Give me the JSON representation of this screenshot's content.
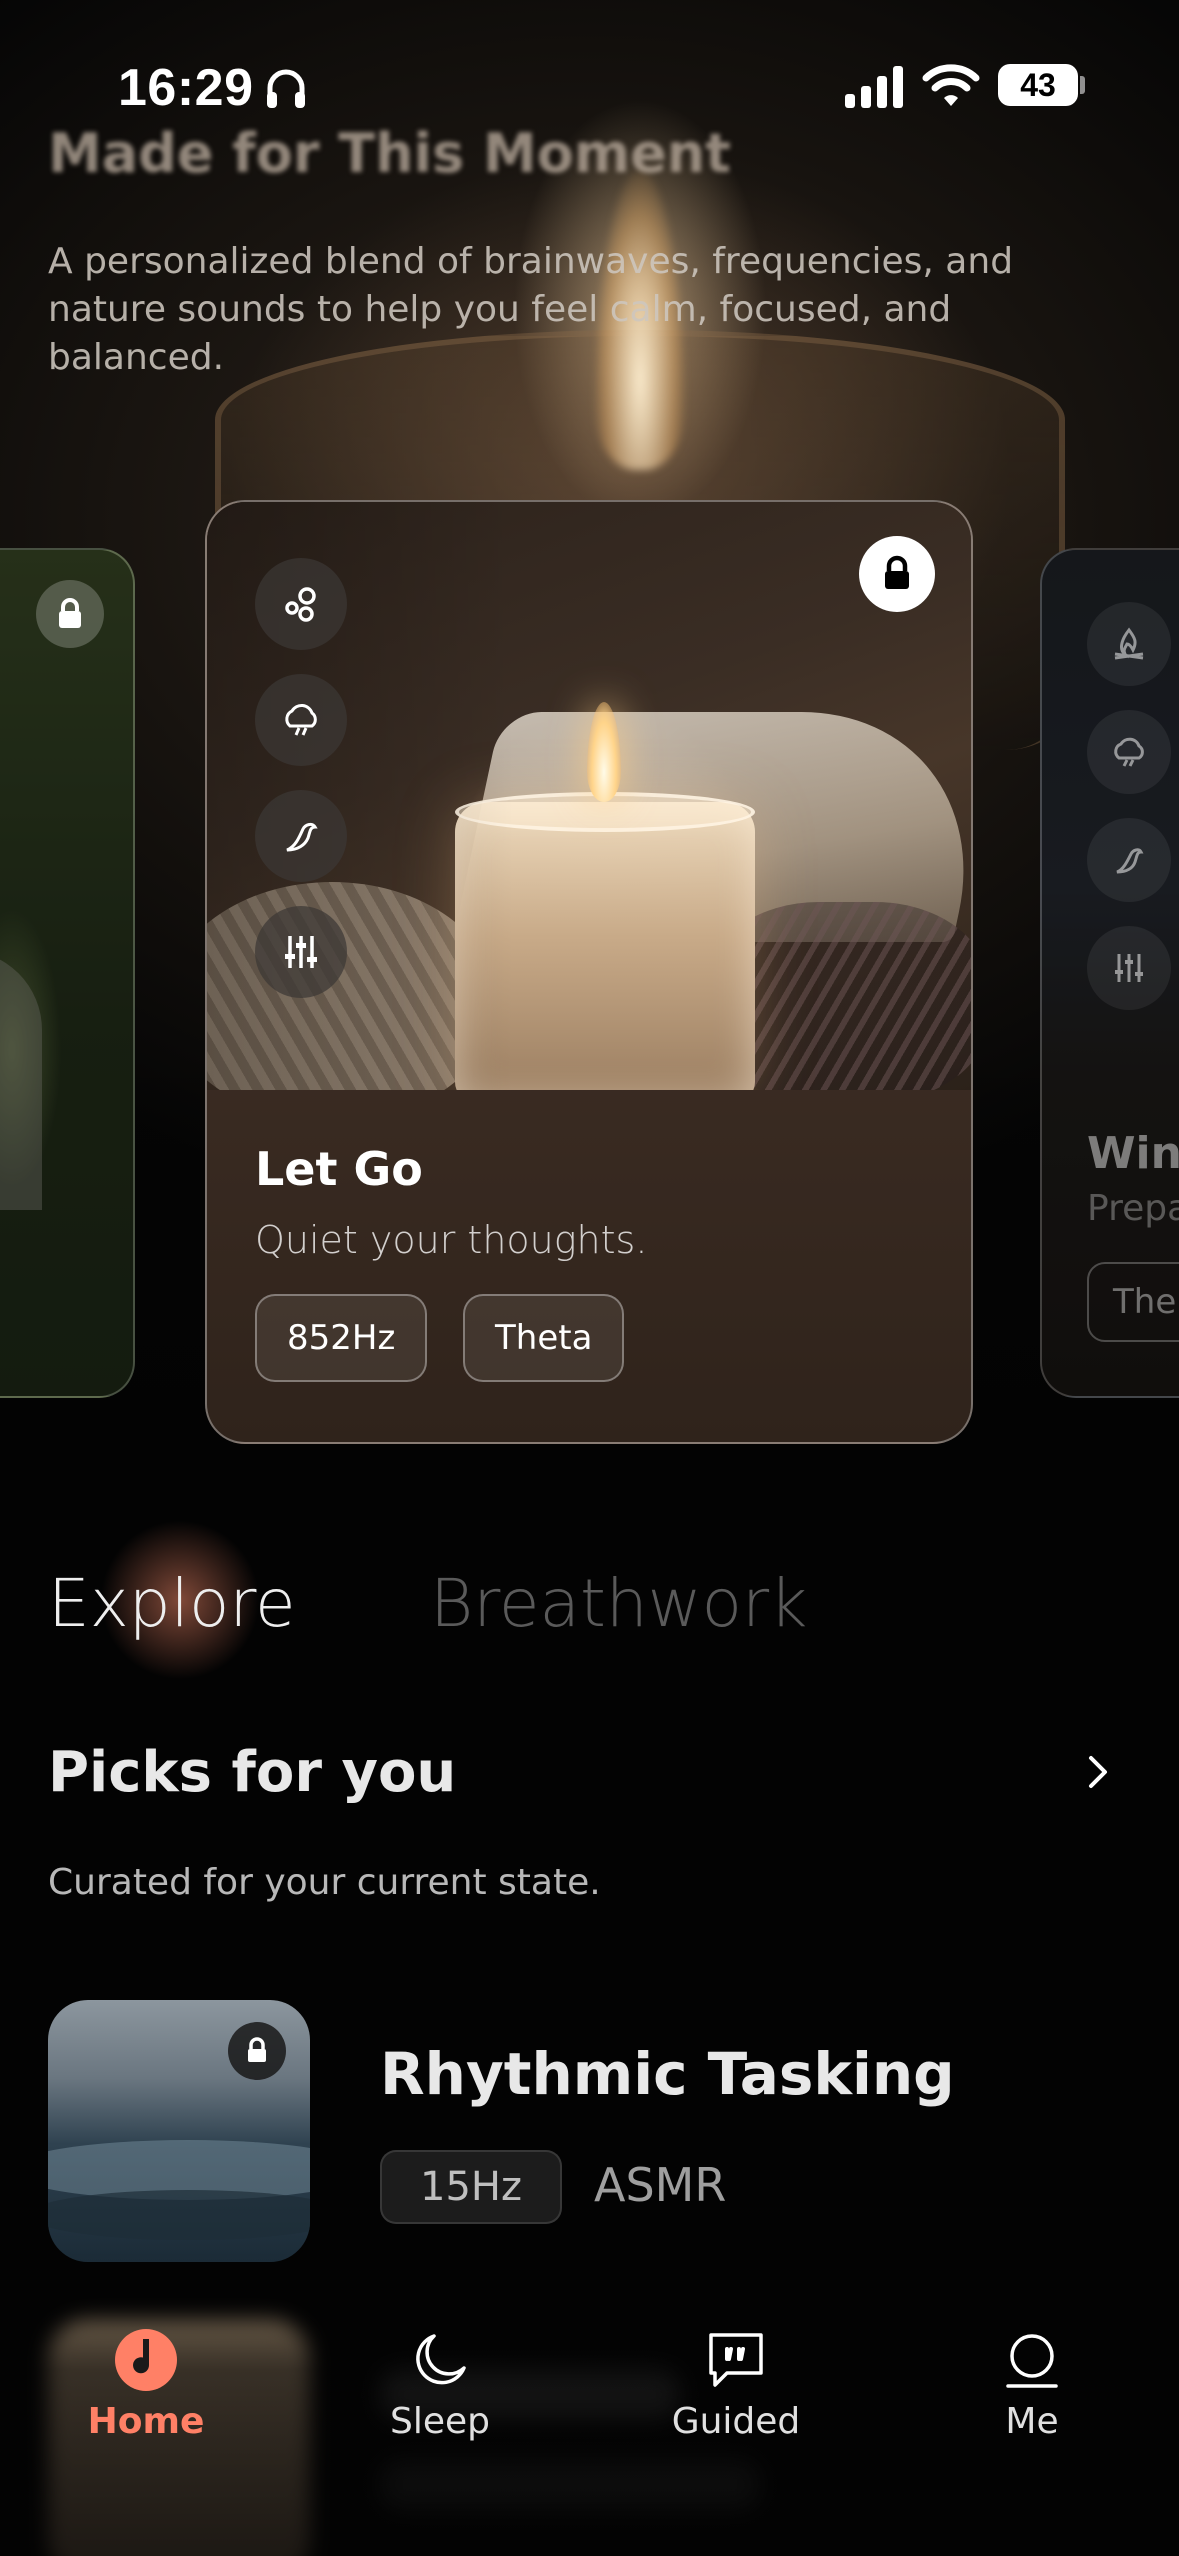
{
  "status_bar": {
    "time": "16:29",
    "battery": "43",
    "icons": [
      "headphones-icon",
      "signal-icon",
      "wifi-icon",
      "battery-icon"
    ]
  },
  "hero": {
    "title": "Made for This Moment",
    "description": "A personalized blend of brainwaves, frequencies, and nature sounds to help you feel calm, focused, and balanced."
  },
  "carousel": {
    "main_card": {
      "title": "Let Go",
      "subtitle": "Quiet your thoughts.",
      "tags": [
        "852Hz",
        "Theta"
      ],
      "locked": true,
      "layer_icons": [
        "bubbles-icon",
        "storm-cloud-icon",
        "bird-icon",
        "sliders-icon"
      ]
    },
    "right_card": {
      "title_partial": "Win",
      "subtitle_partial": "Prepa",
      "tag_partial": "The",
      "layer_icons": [
        "campfire-icon",
        "storm-cloud-icon",
        "bird-icon",
        "sliders-icon"
      ]
    },
    "left_card": {
      "locked": true
    }
  },
  "tabs": [
    {
      "label": "Explore",
      "active": true
    },
    {
      "label": "Breathwork",
      "active": false
    }
  ],
  "picks": {
    "title": "Picks for you",
    "subtitle": "Curated for your current state.",
    "items": [
      {
        "title": "Rhythmic Tasking",
        "tag": "15Hz",
        "category": "ASMR",
        "locked": true
      }
    ]
  },
  "bottom_nav": {
    "items": [
      {
        "label": "Home",
        "icon": "home-note-icon",
        "active": true
      },
      {
        "label": "Sleep",
        "icon": "moon-icon",
        "active": false
      },
      {
        "label": "Guided",
        "icon": "quote-bubble-icon",
        "active": false
      },
      {
        "label": "Me",
        "icon": "person-icon",
        "active": false
      }
    ]
  },
  "colors": {
    "accent": "#ff8066",
    "background": "#030303",
    "card_brown": "#3a2b22"
  }
}
